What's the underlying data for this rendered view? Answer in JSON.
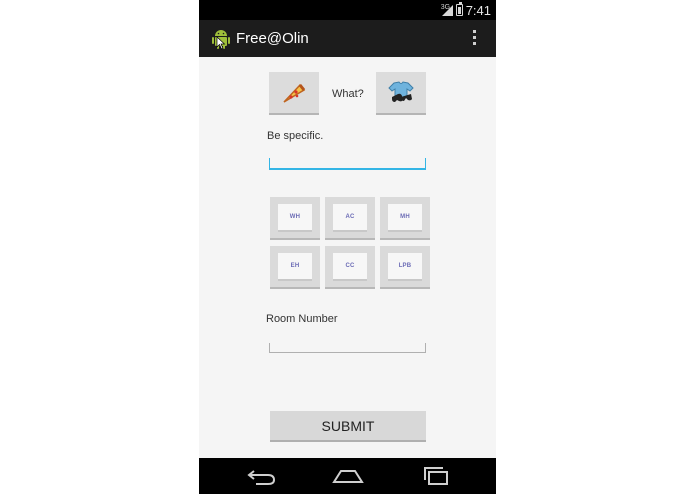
{
  "status_bar": {
    "network": "3G",
    "time": "7:41"
  },
  "action_bar": {
    "title": "Free@Olin",
    "icons": {
      "app": "android-icon",
      "overflow": "overflow-menu-icon"
    }
  },
  "category": {
    "food_icon": "pizza-icon",
    "what_label": "What?",
    "clothes_icon": "clothes-icon"
  },
  "description": {
    "label": "Be specific.",
    "value": ""
  },
  "locations": [
    "WH",
    "AC",
    "MH",
    "EH",
    "CC",
    "LPB"
  ],
  "room": {
    "label": "Room Number",
    "value": ""
  },
  "submit_label": "SUBMIT",
  "nav_bar": {
    "icons": [
      "back-icon",
      "home-icon",
      "recents-icon"
    ]
  }
}
